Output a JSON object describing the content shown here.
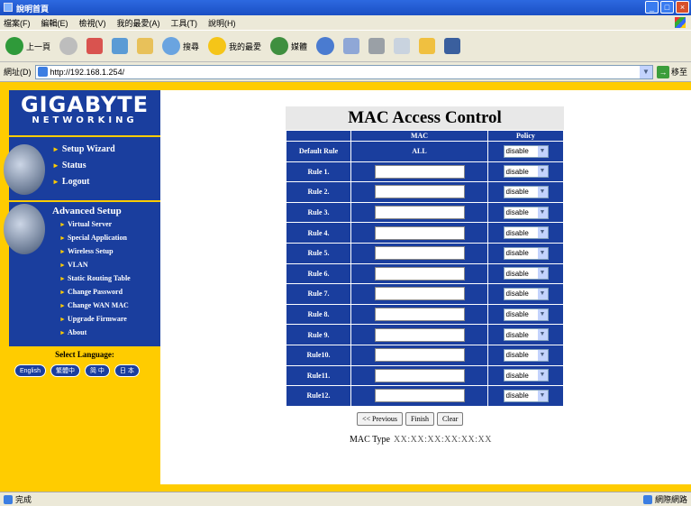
{
  "window": {
    "title": "說明首頁"
  },
  "menubar": [
    "檔案(F)",
    "編輯(E)",
    "檢視(V)",
    "我的最愛(A)",
    "工具(T)",
    "說明(H)"
  ],
  "toolbar": {
    "back": "上一頁",
    "search": "搜尋",
    "favorites": "我的最愛",
    "media": "媒體"
  },
  "address": {
    "label": "網址(D)",
    "url": "http://192.168.1.254/",
    "go": "移至"
  },
  "sidebar": {
    "logo_main": "GIGABYTE",
    "logo_sub": "NETWORKING",
    "nav": [
      "Setup Wizard",
      "Status",
      "Logout"
    ],
    "advanced_title": "Advanced Setup",
    "advanced_items": [
      "Virtual Server",
      "Special Application",
      "Wireless Setup",
      "VLAN",
      "Static Routing Table",
      "Change Password",
      "Change WAN MAC",
      "Upgrade Firmware",
      "About"
    ],
    "language_label": "Select Language:",
    "languages": [
      "English",
      "繁體中",
      "简 中",
      "日 本"
    ]
  },
  "mac": {
    "title": "MAC Access Control",
    "headers": [
      "",
      "MAC",
      "Policy"
    ],
    "default_rule": {
      "label": "Default Rule",
      "mac": "ALL",
      "policy": "disable"
    },
    "rules": [
      {
        "label": "Rule 1.",
        "policy": "disable"
      },
      {
        "label": "Rule 2.",
        "policy": "disable"
      },
      {
        "label": "Rule 3.",
        "policy": "disable"
      },
      {
        "label": "Rule 4.",
        "policy": "disable"
      },
      {
        "label": "Rule 5.",
        "policy": "disable"
      },
      {
        "label": "Rule 6.",
        "policy": "disable"
      },
      {
        "label": "Rule 7.",
        "policy": "disable"
      },
      {
        "label": "Rule 8.",
        "policy": "disable"
      },
      {
        "label": "Rule 9.",
        "policy": "disable"
      },
      {
        "label": "Rule10.",
        "policy": "disable"
      },
      {
        "label": "Rule11.",
        "policy": "disable"
      },
      {
        "label": "Rule12.",
        "policy": "disable"
      }
    ],
    "buttons": {
      "previous": "<< Previous",
      "finish": "Finish",
      "clear": "Clear"
    },
    "mac_type_label": "MAC Type",
    "mac_type_value": "XX:XX:XX:XX:XX:XX"
  },
  "status": {
    "left": "完成",
    "right": "網際網路"
  },
  "colors": {
    "sidebar_blue": "#1a3e9e",
    "frame_yellow": "#ffcc00",
    "xp_blue": "#2d69e0"
  }
}
